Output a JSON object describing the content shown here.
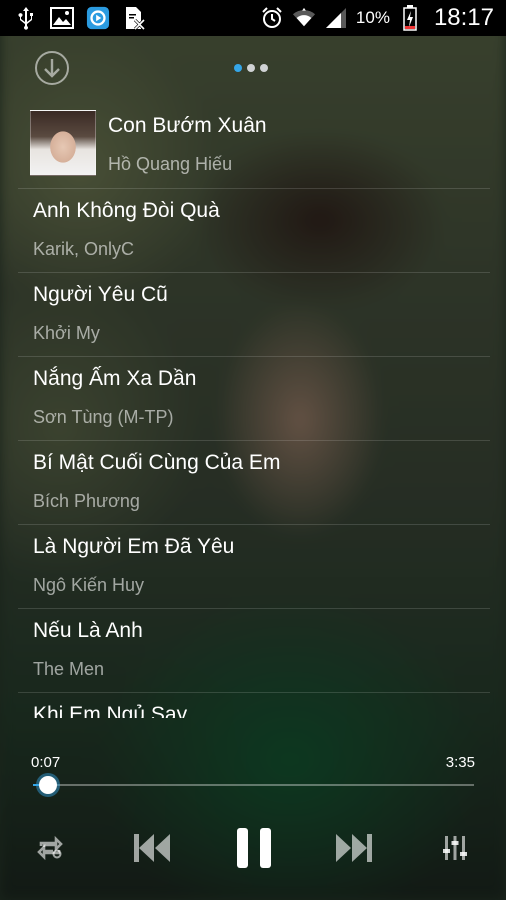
{
  "status_bar": {
    "battery_percent": "10%",
    "time": "18:17"
  },
  "header": {
    "pager_dots": 3,
    "active_dot": 0
  },
  "now_playing": {
    "title": "Con Bướm Xuân",
    "artist": "Hồ Quang Hiếu"
  },
  "playlist": [
    {
      "title": "Anh Không Đòi Quà",
      "artist": "Karik, OnlyC"
    },
    {
      "title": "Người Yêu Cũ",
      "artist": "Khởi My"
    },
    {
      "title": "Nắng Ấm Xa Dần",
      "artist": "Sơn Tùng (M-TP)"
    },
    {
      "title": " Bí Mật Cuối Cùng Của Em",
      "artist": "Bích Phương"
    },
    {
      "title": "Là Người Em Đã Yêu",
      "artist": "Ngô Kiến Huy"
    },
    {
      "title": "Nếu Là Anh",
      "artist": "The Men"
    },
    {
      "title": "Khi Em Ngủ Say",
      "artist": ""
    }
  ],
  "progress": {
    "elapsed": "0:07",
    "total": "3:35",
    "fraction": 0.033
  },
  "colors": {
    "accent": "#35a6e8",
    "text_primary": "#ffffff",
    "text_secondary": "#b7bbb5"
  },
  "icons": [
    "usb-icon",
    "gallery-icon",
    "app-icon",
    "document-icon",
    "alarm-icon",
    "wifi-icon",
    "signal-icon",
    "battery-charging-icon",
    "download-icon",
    "repeat-icon",
    "previous-icon",
    "pause-icon",
    "next-icon",
    "equalizer-icon"
  ]
}
